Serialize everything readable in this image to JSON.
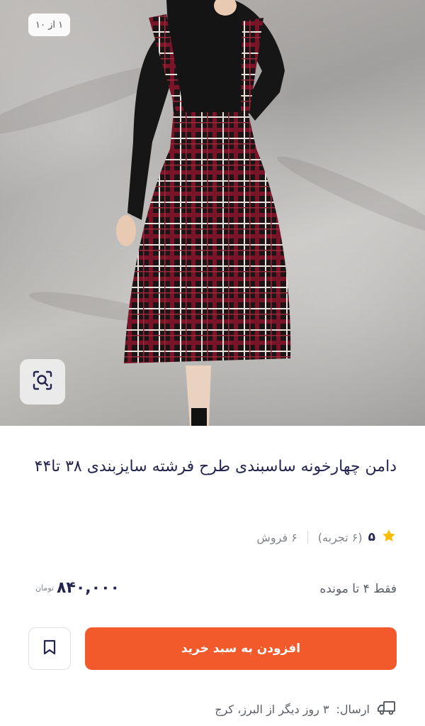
{
  "gallery": {
    "counter": "۱ از ۱۰"
  },
  "product": {
    "title": "دامن چهارخونه ساسبندی طرح فرشته سایزبندی ۳۸ تا۴۴",
    "rating_value": "۵",
    "rating_count": "(۶ تجربه)",
    "sales": "۶ فروش",
    "stock_text": "فقط ۴ تا مونده",
    "price": "۸۴۰,۰۰۰",
    "currency": "تومان"
  },
  "actions": {
    "add_to_cart_label": "افزودن به سبد خرید"
  },
  "shipping": {
    "label": "ارسال:",
    "detail": "۳ روز دیگر از البرز، کرج"
  },
  "colors": {
    "accent": "#f25a2b",
    "star": "#f9bc00",
    "text": "#23254e",
    "muted": "#81858b"
  },
  "icons": [
    "visual-search-icon",
    "star-icon",
    "bookmark-icon",
    "truck-icon"
  ]
}
